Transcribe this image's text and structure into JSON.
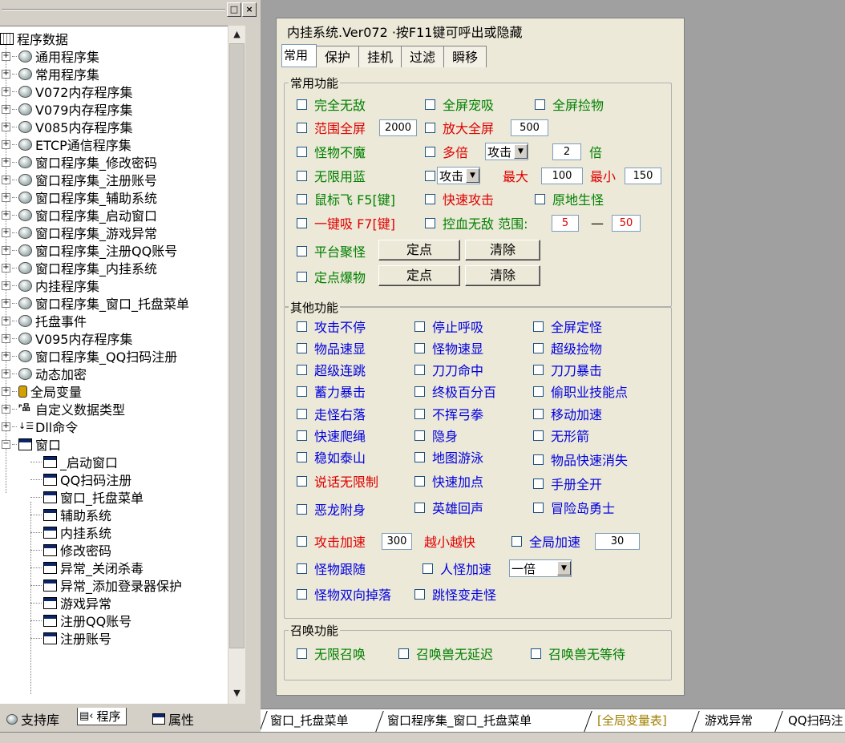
{
  "left_panel": {
    "tree_root": "程序数据",
    "tree_items": [
      "通用程序集",
      "常用程序集",
      "V072内存程序集",
      "V079内存程序集",
      "V085内存程序集",
      "ETCP通信程序集",
      "窗口程序集_修改密码",
      "窗口程序集_注册账号",
      "窗口程序集_辅助系统",
      "窗口程序集_启动窗口",
      "窗口程序集_游戏异常",
      "窗口程序集_注册QQ账号",
      "窗口程序集_内挂系统",
      "内挂程序集",
      "窗口程序集_窗口_托盘菜单",
      "托盘事件",
      "V095内存程序集",
      "窗口程序集_QQ扫码注册",
      "动态加密"
    ],
    "global_var": "全局变量",
    "custom_types": "自定义数据类型",
    "dll_cmd": "Dll命令",
    "windows_folder": "窗口",
    "windows": [
      "_启动窗口",
      "QQ扫码注册",
      "窗口_托盘菜单",
      "辅助系统",
      "内挂系统",
      "修改密码",
      "异常_关闭杀毒",
      "异常_添加登录器保护",
      "游戏异常",
      "注册QQ账号",
      "注册账号"
    ],
    "tabs": [
      "支持库",
      "程序",
      "属性"
    ]
  },
  "form": {
    "title": "内挂系统.Ver072 ·按F11键可呼出或隐藏",
    "tabs": [
      "常用",
      "保护",
      "挂机",
      "过滤",
      "瞬移"
    ],
    "common": {
      "group_title": "常用功能",
      "full_invincible": "完全无敌",
      "full_pet_suck": "全屏宠吸",
      "full_pickup": "全屏捡物",
      "range_full": "范围全屏",
      "range_full_val": "2000",
      "zoom_full": "放大全屏",
      "zoom_full_val": "500",
      "monster_no_magic": "怪物不魔",
      "multi": "多倍",
      "multi_select": "攻击",
      "multi_val": "2",
      "multi_unit": "倍",
      "unlimited_mp": "无限用蓝",
      "atk_select": "攻击",
      "max_label": "最大",
      "max_val": "100",
      "min_label": "最小",
      "min_val": "150",
      "mouse_fly": "鼠标飞 F5[键]",
      "fast_attack": "快速攻击",
      "spawn_in_place": "原地生怪",
      "one_key_suck": "一键吸 F7[键]",
      "blood_invincible": "控血无敌 范围:",
      "range_a": "5",
      "range_dash": "—",
      "range_b": "50",
      "platform_gather": "平台聚怪",
      "fixed_drop": "定点爆物",
      "btn_fix": "定点",
      "btn_clear": "清除"
    },
    "other": {
      "group_title": "其他功能",
      "rows": [
        [
          "攻击不停",
          "停止呼吸",
          "全屏定怪"
        ],
        [
          "物品速显",
          "怪物速显",
          "超级捡物"
        ],
        [
          "超级连跳",
          "刀刀命中",
          "刀刀暴击"
        ],
        [
          "蓄力暴击",
          "终极百分百",
          "偷职业技能点"
        ],
        [
          "走怪右落",
          "不挥弓拳",
          "移动加速"
        ],
        [
          "快速爬绳",
          "隐身",
          "无形箭"
        ],
        [
          "稳如泰山",
          "地图游泳",
          "物品快速消失"
        ],
        [
          "说话无限制",
          "快速加点",
          "手册全开"
        ],
        [
          "恶龙附身",
          "英雄回声",
          "冒险岛勇士"
        ]
      ],
      "attack_speed": "攻击加速",
      "attack_speed_val": "300",
      "smaller_faster": "越小越快",
      "global_speed": "全局加速",
      "global_speed_val": "30",
      "monster_follow": "怪物跟随",
      "char_monster_speed": "人怪加速",
      "speed_select": "一倍",
      "monster_double_drop": "怪物双向掉落",
      "jump_monster": "跳怪变走怪"
    },
    "summon": {
      "group_title": "召唤功能",
      "items": [
        "无限召唤",
        "召唤兽无延迟",
        "召唤兽无等待"
      ]
    }
  },
  "bottom_tabs": [
    "窗口_托盘菜单",
    "窗口程序集_窗口_托盘菜单",
    "[全局变量表]",
    "游戏异常",
    "QQ扫码注"
  ],
  "colors": {
    "green": "#008000",
    "red": "#e00000",
    "blue": "#0000e0"
  }
}
